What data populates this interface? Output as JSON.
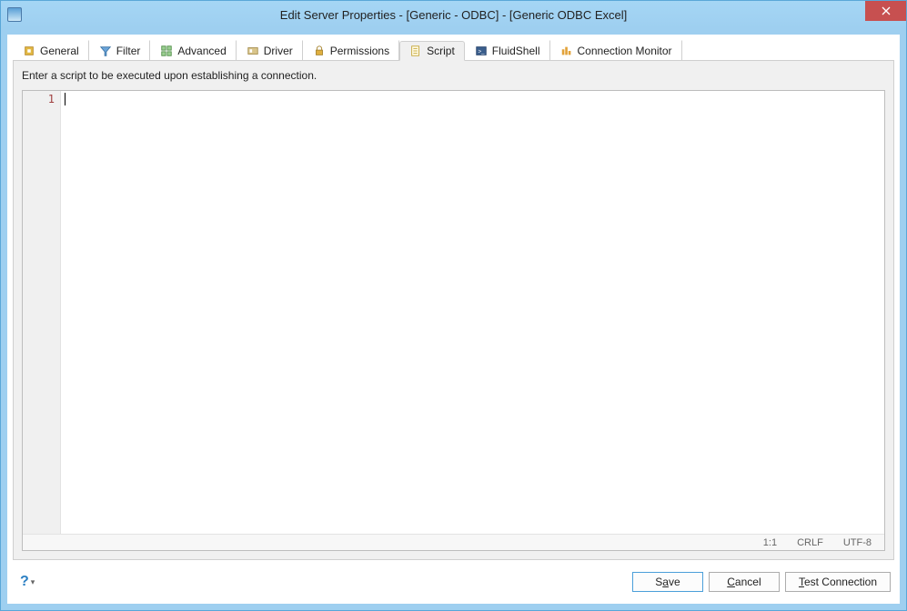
{
  "window": {
    "title": "Edit Server Properties - [Generic - ODBC] - [Generic ODBC Excel]"
  },
  "tabs": [
    {
      "id": "general",
      "label": "General"
    },
    {
      "id": "filter",
      "label": "Filter"
    },
    {
      "id": "advanced",
      "label": "Advanced"
    },
    {
      "id": "driver",
      "label": "Driver"
    },
    {
      "id": "permissions",
      "label": "Permissions"
    },
    {
      "id": "script",
      "label": "Script",
      "active": true
    },
    {
      "id": "fluidshell",
      "label": "FluidShell"
    },
    {
      "id": "connectionmonitor",
      "label": "Connection Monitor"
    }
  ],
  "panel": {
    "hint": "Enter a script to be executed upon establishing a connection.",
    "gutter_line": "1",
    "code_value": ""
  },
  "status": {
    "position": "1:1",
    "eol": "CRLF",
    "encoding": "UTF-8"
  },
  "buttons": {
    "save_pre": "S",
    "save_key": "a",
    "save_post": "ve",
    "cancel_pre": "",
    "cancel_key": "C",
    "cancel_post": "ancel",
    "test_pre": "",
    "test_key": "T",
    "test_post": "est Connection"
  },
  "help": {
    "glyph": "?"
  }
}
